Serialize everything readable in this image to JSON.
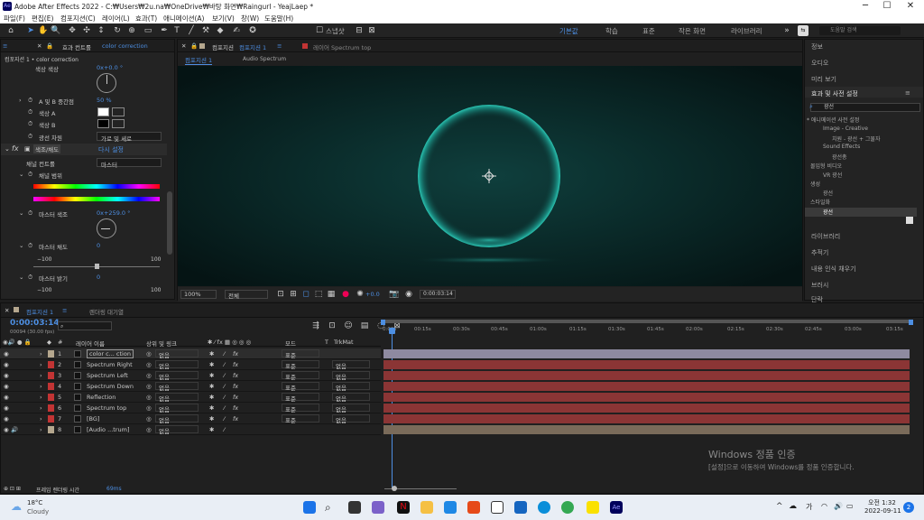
{
  "titlebar": {
    "text": "Adobe After Effects 2022 - C:₩Users₩2u.na₩OneDrive₩바탕 화면₩Raingurl - YeajLaep *",
    "min": "─",
    "max": "☐",
    "close": "✕"
  },
  "menu": [
    "파일(F)",
    "편집(E)",
    "컴포지션(C)",
    "레이어(L)",
    "효과(T)",
    "애니메이션(A)",
    "보기(V)",
    "창(W)",
    "도움말(H)"
  ],
  "toolbar": {
    "snap_label": "스냅샷",
    "workspaces": [
      "기본값",
      "학습",
      "표준",
      "작은 화면",
      "라이브러리"
    ],
    "active": "기본값",
    "search_placeholder": "도움말 검색"
  },
  "effects_panel": {
    "tab_prefix": "효과 컨트롤",
    "tab_layer": "color correction",
    "header": "컴포지션 1 • color correction",
    "hue_label": "색상 색상",
    "hue_value": "0x+0.0 °",
    "ab_label": "A 및 B 중간점",
    "ab_value": "50 %",
    "color_a": "색상 A",
    "color_b": "색상 B",
    "grad_label": "광선 차원",
    "grad_value": "가로 및 세로",
    "fx_name": "색조/채도",
    "fx_reset": "다시 설정",
    "channel_label": "채널 컨트롤",
    "channel_value": "마스터",
    "channel_range": "채널 범위",
    "master_hue": "마스터 색조",
    "master_hue_value": "0x+259.0 °",
    "master_sat": "마스터 채도",
    "master_sat_value": "0",
    "min": "−100",
    "max": "100",
    "master_light": "마스터 밝기",
    "master_light_value": "0"
  },
  "comp_panel": {
    "tab": "컴포지션",
    "tab_name": "컴포지션 1",
    "layer_tab": "레이어 Spectrum top",
    "subtab1": "컴포지션 1",
    "subtab2": "Audio Spectrum",
    "zoom": "100%",
    "res": "전체",
    "exposure": "+0.0",
    "timecode": "0:00:03:14"
  },
  "right_panel": {
    "items": [
      "정보",
      "오디오",
      "미리 보기",
      "효과 및 사전 설정"
    ],
    "search_value": "광선",
    "tree": [
      "* 애니메이션 사전 설정",
      "Image - Creative",
      "치원 - 광선 + 그물자",
      "Sound Effects",
      "광선총",
      "몰입형 비디오",
      "VR 광선",
      "생성",
      "광선",
      "스타일화",
      "광선"
    ],
    "lower": [
      "라이브러리",
      "추적기",
      "내용 인식 채우기",
      "브러시",
      "단락"
    ]
  },
  "timeline": {
    "tab": "컴포지션 1",
    "render_queue": "렌더링 대기열",
    "timecode": "0:00:03:14",
    "fps": "00094 (30.00 fps)",
    "col_name": "레이어 이름",
    "col_parent": "상위 및 링크",
    "col_mode": "모드",
    "col_t": "T",
    "col_trkmat": "TrkMat",
    "ruler": [
      "0:00s",
      "00:15s",
      "00:30s",
      "00:45s",
      "01:00s",
      "01:15s",
      "01:30s",
      "01:45s",
      "02:00s",
      "02:15s",
      "02:30s",
      "02:45s",
      "03:00s",
      "03:15s"
    ],
    "layers": [
      {
        "num": "1",
        "name": "color c... ction",
        "mode": "표준",
        "parent": "없음",
        "trk": "",
        "color": "#b5a78e"
      },
      {
        "num": "2",
        "name": "Spectrum Right",
        "mode": "표준",
        "parent": "없음",
        "trk": "없음",
        "color": "#c23434"
      },
      {
        "num": "3",
        "name": "Spectrum Left",
        "mode": "표준",
        "parent": "없음",
        "trk": "없음",
        "color": "#c23434"
      },
      {
        "num": "4",
        "name": "Spectrum Down",
        "mode": "표준",
        "parent": "없음",
        "trk": "없음",
        "color": "#c23434"
      },
      {
        "num": "5",
        "name": "Reflection",
        "mode": "표준",
        "parent": "없음",
        "trk": "없음",
        "color": "#c23434"
      },
      {
        "num": "6",
        "name": "Spectrum top",
        "mode": "표준",
        "parent": "없음",
        "trk": "없음",
        "color": "#c23434"
      },
      {
        "num": "7",
        "name": "[BG]",
        "mode": "표준",
        "parent": "없음",
        "trk": "없음",
        "color": "#c23434"
      },
      {
        "num": "8",
        "name": "[Audio ...trum]",
        "mode": "",
        "parent": "없음",
        "trk": "",
        "color": "#b5a78e"
      }
    ],
    "footer": "프레임 렌더링 시간",
    "footer_value": "69ms"
  },
  "watermark": {
    "title": "Windows 정품 인증",
    "sub": "[설정]으로 이동하여 Windows를 정품 인증합니다."
  },
  "taskbar": {
    "temp": "18°C",
    "weather": "Cloudy",
    "ime": "가",
    "time": "오전 1:32",
    "date": "2022-09-11",
    "badge": "2"
  }
}
